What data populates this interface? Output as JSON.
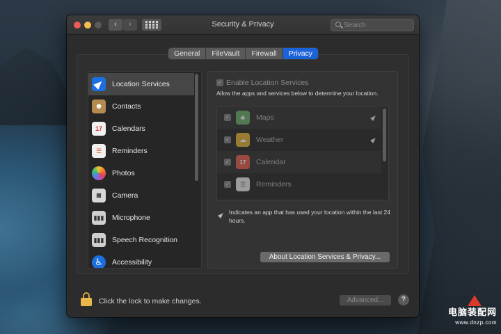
{
  "window": {
    "title": "Security & Privacy",
    "nav_back_glyph": "‹",
    "nav_forward_glyph": "›"
  },
  "search": {
    "placeholder": "Search",
    "value": ""
  },
  "tabs": [
    {
      "label": "General",
      "selected": false
    },
    {
      "label": "FileVault",
      "selected": false
    },
    {
      "label": "Firewall",
      "selected": false
    },
    {
      "label": "Privacy",
      "selected": true
    }
  ],
  "sidebar": {
    "items": [
      {
        "label": "Location Services",
        "icon": "location-arrow-icon",
        "color": "#1b6fe0",
        "selected": true
      },
      {
        "label": "Contacts",
        "icon": "contacts-icon",
        "color": "#b58a4e",
        "selected": false
      },
      {
        "label": "Calendars",
        "icon": "calendar-icon",
        "color": "#f0f0f0",
        "selected": false
      },
      {
        "label": "Reminders",
        "icon": "reminders-icon",
        "color": "#f0f0f0",
        "selected": false
      },
      {
        "label": "Photos",
        "icon": "photos-icon",
        "color": "#f5f5f5",
        "selected": false
      },
      {
        "label": "Camera",
        "icon": "camera-icon",
        "color": "#d8d8d8",
        "selected": false
      },
      {
        "label": "Microphone",
        "icon": "microphone-icon",
        "color": "#cfcfcf",
        "selected": false
      },
      {
        "label": "Speech Recognition",
        "icon": "speech-recognition-icon",
        "color": "#cfcfcf",
        "selected": false
      },
      {
        "label": "Accessibility",
        "icon": "accessibility-icon",
        "color": "#1b6fe0",
        "selected": false
      }
    ]
  },
  "location": {
    "enable_label": "Enable Location Services",
    "enable_checked": true,
    "description": "Allow the apps and services below to determine your location.",
    "apps": [
      {
        "label": "Maps",
        "icon": "maps-icon",
        "color": "#6aa86a",
        "checked": true,
        "recent": true
      },
      {
        "label": "Weather",
        "icon": "weather-icon",
        "color": "#e0b23a",
        "checked": true,
        "recent": true
      },
      {
        "label": "Calendar",
        "icon": "calendar-icon",
        "color": "#e05a4a",
        "checked": true,
        "recent": false
      },
      {
        "label": "Reminders",
        "icon": "reminders-icon",
        "color": "#e8e8e8",
        "checked": true,
        "recent": false
      }
    ],
    "note": "Indicates an app that has used your location within the last 24 hours.",
    "about_button": "About Location Services & Privacy..."
  },
  "footer": {
    "lock_text": "Click the lock to make changes.",
    "advanced_button": "Advanced...",
    "help_glyph": "?"
  },
  "watermark": {
    "cn": "电脑装配网",
    "url": "www.dnzp.com"
  }
}
